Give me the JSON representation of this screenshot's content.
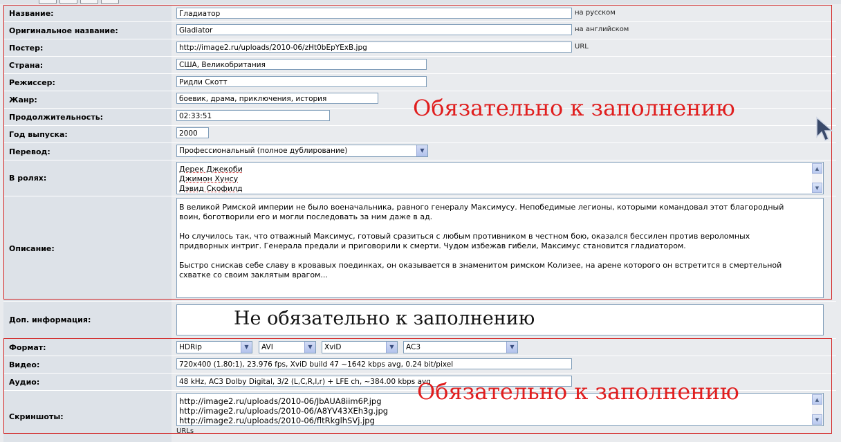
{
  "fields": {
    "title": {
      "label": "Название:",
      "value": "Гладиатор",
      "hint": "на русском"
    },
    "orig_title": {
      "label": "Оригинальное название:",
      "value": "Gladiator",
      "hint": "на английском"
    },
    "poster": {
      "label": "Постер:",
      "value": "http://image2.ru/uploads/2010-06/zHt0bEpYExB.jpg",
      "hint": "URL"
    },
    "country": {
      "label": "Страна:",
      "value": "США, Великобритания"
    },
    "director": {
      "label": "Режиссер:",
      "value": "Ридли Скотт"
    },
    "genre": {
      "label": "Жанр:",
      "value": "боевик, драма, приключения, история"
    },
    "duration": {
      "label": "Продолжительность:",
      "value": "02:33:51"
    },
    "year": {
      "label": "Год выпуска:",
      "value": "2000"
    },
    "translation": {
      "label": "Перевод:",
      "value": "Профессиональный (полное дублирование)"
    },
    "cast": {
      "label": "В ролях:",
      "lines": [
        "Дерек Джекоби",
        "Джимон Хунсу",
        "Дэвид Скофилд"
      ]
    },
    "description": {
      "label": "Описание:",
      "paragraphs": [
        "В великой Римской империи не было военачальника, равного генералу Максимусу. Непобедимые легионы, которыми командовал этот благородный воин, боготворили его и могли последовать за ним даже в ад.",
        "Но случилось так, что отважный Максимус, готовый сразиться с любым противником в честном бою, оказался бессилен против вероломных придворных интриг. Генерала предали и приговорили к смерти. Чудом избежав гибели, Максимус становится гладиатором.",
        "Быстро снискав себе славу в кровавых поединках, он оказывается в знаменитом римском Колизее, на арене которого он встретится в смертельной схватке со своим заклятым врагом..."
      ]
    },
    "extra": {
      "label": "Доп. информация:"
    },
    "format": {
      "label": "Формат:",
      "container": "HDRip",
      "ext": "AVI",
      "vcodec": "XviD",
      "acodec": "AC3"
    },
    "video": {
      "label": "Видео:",
      "value": "720x400 (1.80:1), 23.976 fps, XviD build 47 ~1642 kbps avg, 0.24 bit/pixel"
    },
    "audio": {
      "label": "Аудио:",
      "value": "48 kHz, AC3 Dolby Digital, 3/2 (L,C,R,l,r) + LFE ch, ~384.00 kbps avg"
    },
    "screens": {
      "label": "Скриншоты:",
      "lines": [
        "http://image2.ru/uploads/2010-06/JbAUA8iim6P.jpg",
        "http://image2.ru/uploads/2010-06/A8YV43XEh3g.jpg",
        "http://image2.ru/uploads/2010-06/fltRkglhSVj.jpg"
      ],
      "hint": "URLs"
    }
  },
  "annotations": {
    "required1": "Обязательно к заполнению",
    "optional": "Не обязательно к заполнению",
    "required2": "Обязательно к заполнению"
  },
  "colors": {
    "annotation_red": "#e01e1e",
    "label_bg": "#dde2e8",
    "value_bg": "#e9ebee"
  }
}
